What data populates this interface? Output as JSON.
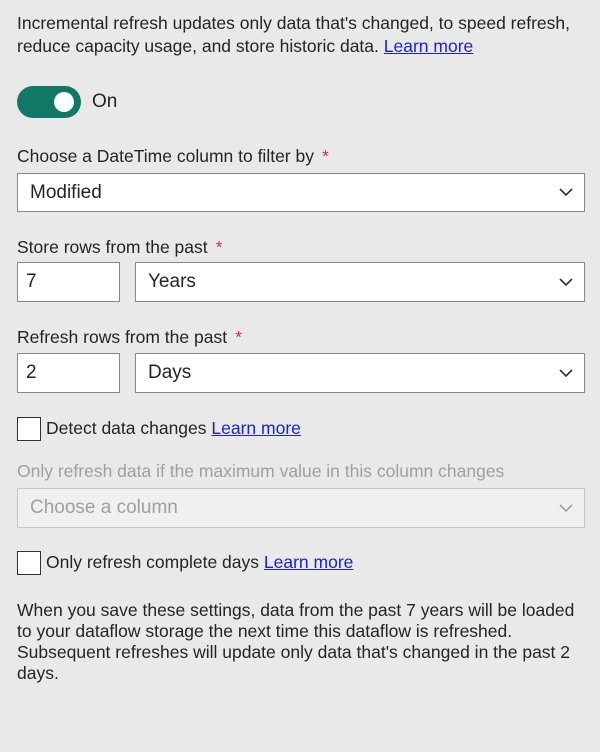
{
  "intro": {
    "text": "Incremental refresh updates only data that's changed, to speed refresh, reduce capacity usage, and store historic data.",
    "link": "Learn more"
  },
  "toggle": {
    "state": true,
    "label": "On",
    "accent": "#117865"
  },
  "datetime_column": {
    "label": "Choose a DateTime column to filter by",
    "required_mark": "*",
    "value": "Modified"
  },
  "store_rows": {
    "label": "Store rows from the past",
    "required_mark": "*",
    "number": "7",
    "unit": "Years"
  },
  "refresh_rows": {
    "label": "Refresh rows from the past",
    "required_mark": "*",
    "number": "2",
    "unit": "Days"
  },
  "detect_changes": {
    "label": "Detect data changes",
    "link": "Learn more",
    "checked": false
  },
  "max_value_column": {
    "label": "Only refresh data if the maximum value in this column changes",
    "placeholder": "Choose a column",
    "disabled": true
  },
  "complete_days": {
    "label": "Only refresh complete days",
    "link": "Learn more",
    "checked": false
  },
  "footer": {
    "text": "When you save these settings, data from the past 7 years will be loaded to your dataflow storage the next time this dataflow is refreshed. Subsequent refreshes will update only data that's changed in the past 2 days."
  },
  "colors": {
    "background": "#e9e9e9",
    "link": "#1b23c8",
    "required": "#d13438"
  }
}
